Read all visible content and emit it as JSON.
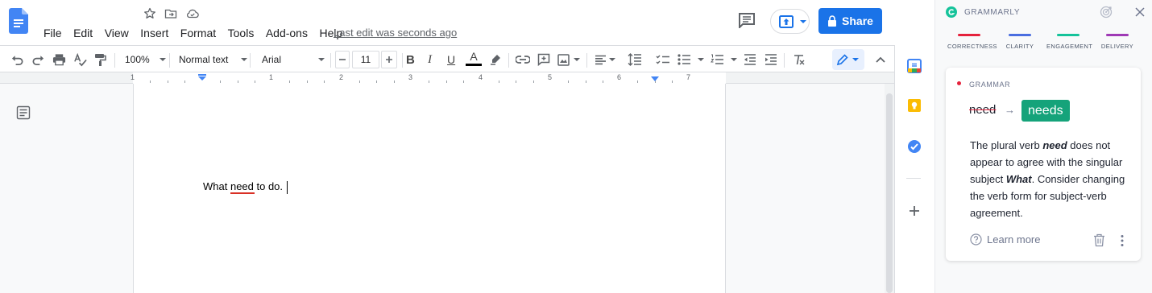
{
  "menu": {
    "items": [
      "File",
      "Edit",
      "View",
      "Insert",
      "Format",
      "Tools",
      "Add-ons",
      "Help"
    ],
    "last_edit": "Last edit was seconds ago"
  },
  "share_label": "Share",
  "toolbar": {
    "zoom": "100%",
    "style": "Normal text",
    "font": "Arial",
    "font_size": "11"
  },
  "ruler": {
    "numbers": [
      "1",
      "1",
      "2",
      "3",
      "4",
      "5",
      "6",
      "7"
    ]
  },
  "document": {
    "text_before": "What ",
    "flagged_word": "need",
    "text_after": " to do."
  },
  "grammarly": {
    "title": "GRAMMARLY",
    "categories": [
      {
        "label": "CORRECTNESS",
        "color": "#e5223c"
      },
      {
        "label": "CLARITY",
        "color": "#4a6ee0"
      },
      {
        "label": "ENGAGEMENT",
        "color": "#15c39a"
      },
      {
        "label": "DELIVERY",
        "color": "#9f3ab5"
      }
    ],
    "card": {
      "kind": "GRAMMAR",
      "original": "need",
      "suggestion": "needs",
      "desc_1": "The plural verb ",
      "desc_word": "need",
      "desc_2": " does not appear to agree with the singular subject ",
      "desc_subject": "What",
      "desc_3": ". Consider changing the verb form for subject-verb agreement.",
      "learn_more": "Learn more"
    }
  },
  "colors": {
    "accent": "#1a73e8",
    "grammarly_green": "#15c39a",
    "error_red": "#d93025"
  }
}
